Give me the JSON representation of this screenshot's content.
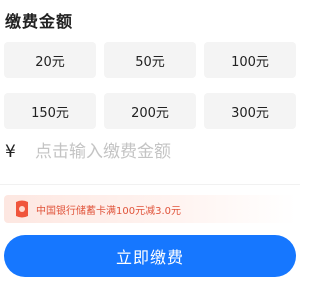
{
  "section_title": "缴费金额",
  "amount_options": [
    "20元",
    "50元",
    "100元",
    "150元",
    "200元",
    "300元"
  ],
  "input": {
    "currency_symbol": "¥",
    "placeholder": "点击输入缴费金额",
    "value": ""
  },
  "promo": {
    "icon": "red-coupon-icon",
    "text": "中国银行储蓄卡满100元减3.0元",
    "color": "#e0533a"
  },
  "pay_button": {
    "label": "立即缴费",
    "color": "#1677ff"
  }
}
